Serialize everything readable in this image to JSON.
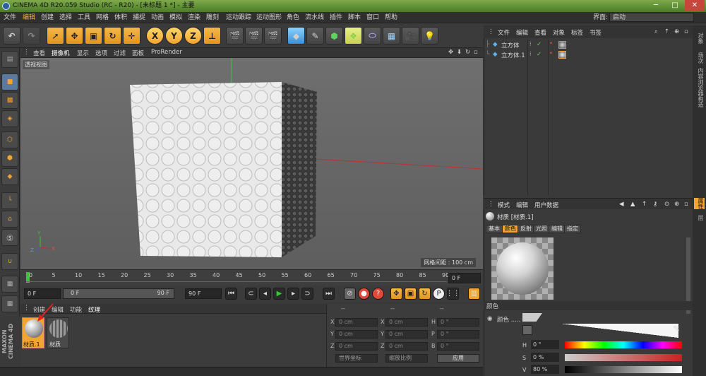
{
  "app": {
    "title": "CINEMA 4D R20.059 Studio (RC - R20) - [未标题 1 *] - 主要",
    "window_min": "─",
    "window_max": "□",
    "window_close": "✕"
  },
  "menubar": {
    "items": [
      "文件",
      "编辑",
      "创建",
      "选择",
      "工具",
      "网格",
      "体积",
      "捕捉",
      "动画",
      "模拟",
      "渲染",
      "雕刻",
      "运动跟踪",
      "运动图形",
      "角色",
      "流水线",
      "插件",
      "脚本",
      "窗口",
      "帮助"
    ],
    "layout_label": "界面:",
    "layout_value": "启动"
  },
  "toolbar": {
    "x_label": "X",
    "y_label": "Y",
    "z_label": "Z"
  },
  "viewport": {
    "menu": [
      "查看",
      "摄像机",
      "显示",
      "选项",
      "过滤",
      "面板",
      "ProRender"
    ],
    "view_name": "透视视图",
    "grid_spacing": "网格间距 : 100 cm",
    "axis_y": "Y",
    "axis_z": "Z",
    "axis_x": "X"
  },
  "timeline": {
    "ticks": [
      "0",
      "5",
      "10",
      "15",
      "20",
      "25",
      "30",
      "35",
      "40",
      "45",
      "50",
      "55",
      "60",
      "65",
      "70",
      "75",
      "80",
      "85",
      "90"
    ],
    "current_frame": "0 F"
  },
  "transport": {
    "start_frame": "0 F",
    "range_start": "0 F",
    "range_end": "90 F",
    "end_frame": "90 F"
  },
  "material_manager": {
    "menu": [
      "创建",
      "编辑",
      "功能",
      "纹理"
    ],
    "materials": [
      {
        "name": "材质.1",
        "selected": true
      },
      {
        "name": "材质",
        "selected": false
      }
    ]
  },
  "coordinates": {
    "headers": [
      "--",
      "--",
      "--"
    ],
    "rows": [
      {
        "a": "X",
        "av": "0 cm",
        "b": "X",
        "bv": "0 cm",
        "c": "H",
        "cv": "0 °"
      },
      {
        "a": "Y",
        "av": "0 cm",
        "b": "Y",
        "bv": "0 cm",
        "c": "P",
        "cv": "0 °"
      },
      {
        "a": "Z",
        "av": "0 cm",
        "b": "Z",
        "bv": "0 cm",
        "c": "B",
        "cv": "0 °"
      }
    ],
    "coord_system": "世界坐标",
    "scale_mode": "缩放比例",
    "apply_label": "应用"
  },
  "object_manager": {
    "menu": [
      "文件",
      "编辑",
      "查看",
      "对象",
      "标签",
      "书签"
    ],
    "objects": [
      {
        "name": "立方体"
      },
      {
        "name": "立方体.1"
      }
    ]
  },
  "attributes": {
    "menu": [
      "模式",
      "编辑",
      "用户数据"
    ],
    "header": "材质 [材质.1]",
    "tabs": [
      "基本",
      "颜色",
      "反射",
      "光照",
      "编辑",
      "指定"
    ],
    "active_tab": "颜色",
    "section": "颜色",
    "color_label": "颜色 .....",
    "h_label": "H",
    "h_value": "0 °",
    "s_label": "S",
    "s_value": "0 %",
    "v_label": "V",
    "v_value": "80 %"
  },
  "right_tabs": [
    "对象",
    "场次",
    "内容浏览器",
    "构造",
    "属性",
    "层"
  ],
  "colors": {
    "accent_orange": "#e3951d",
    "title_green": "#5e8f35",
    "axis_y": "#39c739",
    "axis_x": "#c03030"
  }
}
